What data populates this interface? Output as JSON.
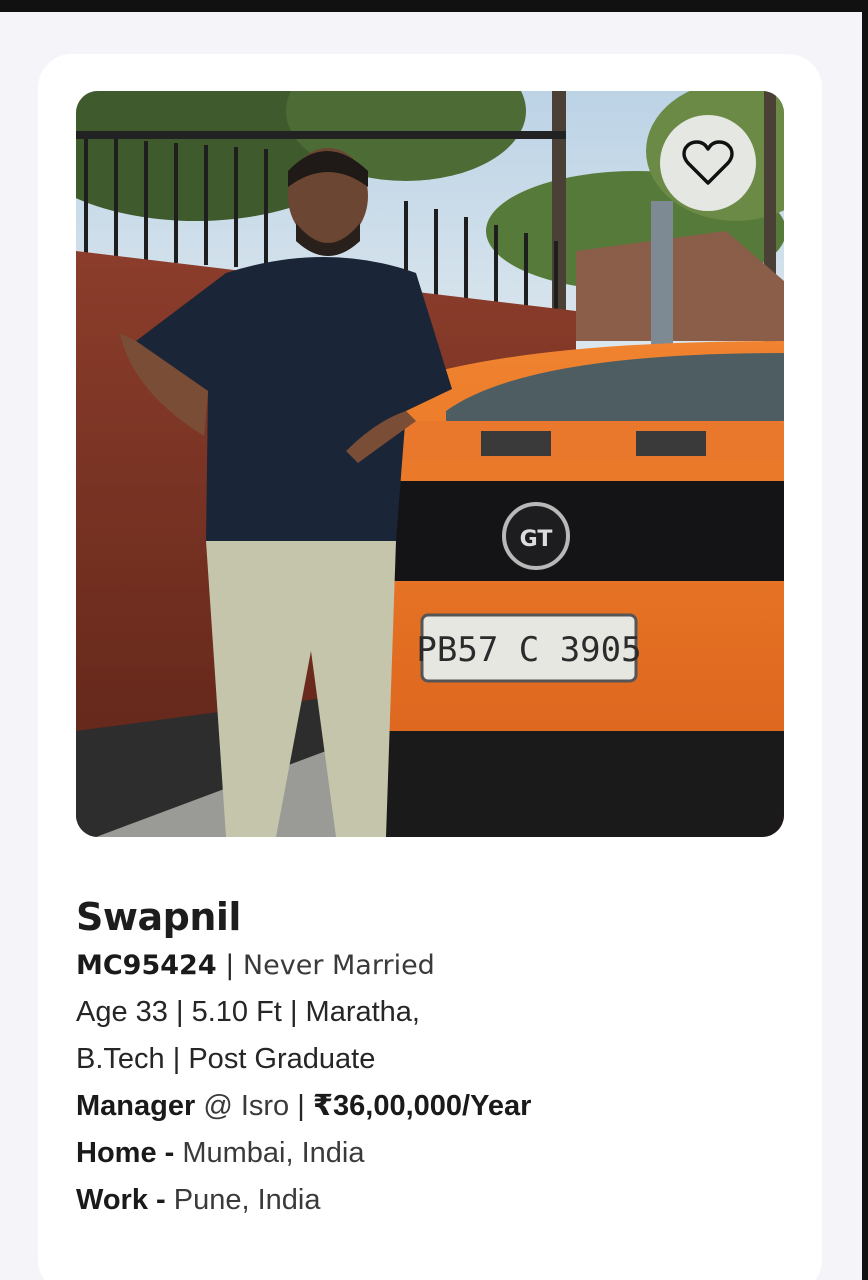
{
  "profile": {
    "name": "Swapnil",
    "id": "MC95424",
    "marital_status": "Never Married",
    "age": "Age 33",
    "height": "5.10 Ft",
    "community": "Maratha,",
    "degree": "B.Tech",
    "education_level": "Post Graduate",
    "designation": "Manager",
    "at": "@",
    "company": "Isro",
    "salary": "₹36,00,000/Year",
    "home_label": "Home -",
    "home": "Mumbai, India",
    "work_label": "Work -",
    "work": "Pune, India",
    "photo_plate_text": "PB57 C 3905",
    "photo_badge_text": "GT"
  },
  "separators": {
    "pipe": "|"
  },
  "icons": {
    "favorite": "heart-outline-icon"
  },
  "colors": {
    "card": "#ffffff",
    "page": "#f5f4f9",
    "text": "#1d1d1d"
  }
}
